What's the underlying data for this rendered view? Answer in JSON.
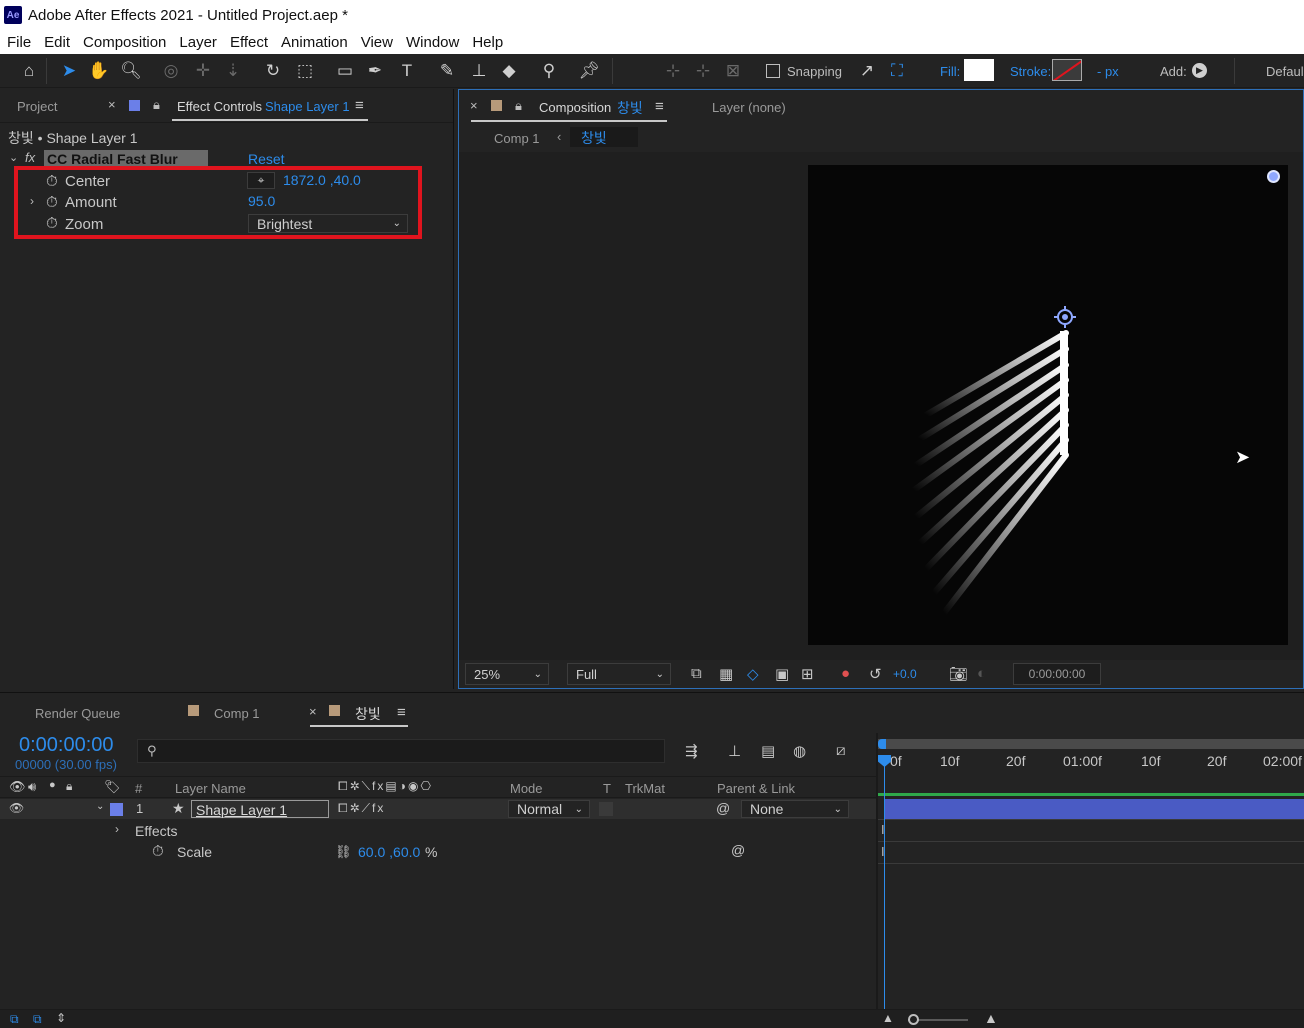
{
  "app": {
    "title": "Adobe After Effects 2021 - Untitled Project.aep *",
    "logo_text": "Ae"
  },
  "menu": [
    "File",
    "Edit",
    "Composition",
    "Layer",
    "Effect",
    "Animation",
    "View",
    "Window",
    "Help"
  ],
  "toolbar": {
    "snapping_label": "Snapping",
    "fill_label": "Fill:",
    "stroke_label": "Stroke:",
    "stroke_width": "- px",
    "add_label": "Add:",
    "workspace_label": "Defaul"
  },
  "left_panel": {
    "tab_project": "Project",
    "tab_effect_controls": "Effect Controls",
    "tab_effect_layer": "Shape Layer 1",
    "breadcrumb": "창빛 • Shape Layer 1",
    "effect_name": "CC Radial Fast Blur",
    "reset_label": "Reset",
    "params": [
      {
        "label": "Center",
        "value": "1872.0 ,40.0"
      },
      {
        "label": "Amount",
        "value": "95.0"
      },
      {
        "label": "Zoom",
        "value": "Brightest"
      }
    ],
    "highlight_color": "#e0141e"
  },
  "viewer": {
    "tab_composition": "Composition",
    "tab_comp_name": "창빛",
    "tab_layer": "Layer (none)",
    "nav_comp1": "Comp 1",
    "nav_current": "창빛",
    "zoom": "25%",
    "resolution": "Full",
    "exposure": "+0.0",
    "timecode": "0:00:00:00"
  },
  "timeline": {
    "tab_render_queue": "Render Queue",
    "tab_comp1": "Comp 1",
    "tab_active": "창빛",
    "timecode": "0:00:00:00",
    "frames_fps": "00000 (30.00 fps)",
    "search_placeholder": "",
    "col_hash": "#",
    "col_layer_name": "Layer Name",
    "col_mode": "Mode",
    "col_t": "T",
    "col_trkmat": "TrkMat",
    "col_parent": "Parent & Link",
    "layer_index": "1",
    "layer_name": "Shape Layer 1",
    "layer_mode": "Normal",
    "layer_parent": "None",
    "effects_label": "Effects",
    "scale_label": "Scale",
    "scale_value": "60.0 ,60.0",
    "scale_unit": "%",
    "ruler": [
      "0f",
      "10f",
      "20f",
      "01:00f",
      "10f",
      "20f",
      "02:00f"
    ]
  },
  "colors": {
    "accent": "#2d8ceb",
    "layer_label": "#6b7fe8",
    "layer_bar": "#4a5bc4",
    "comp_swatch": "#b79a7a"
  }
}
